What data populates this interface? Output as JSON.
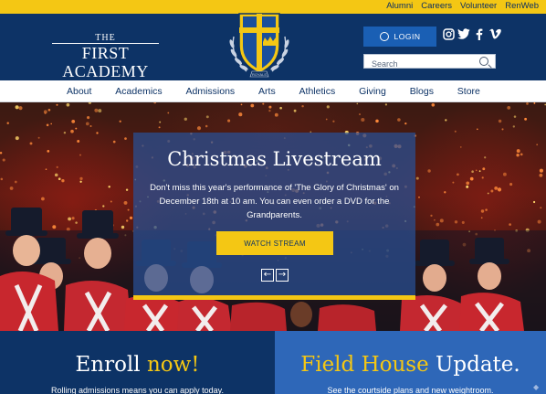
{
  "utility_links": [
    "Alumni",
    "Careers",
    "Volunteer",
    "RenWeb"
  ],
  "logo": {
    "line1": "THE",
    "line2": "FIRST ACADEMY"
  },
  "crest": {
    "label": "ROYALS"
  },
  "login": {
    "label": "LOGIN"
  },
  "social": [
    "instagram-icon",
    "twitter-icon",
    "facebook-icon",
    "vimeo-icon"
  ],
  "search": {
    "placeholder": "Search"
  },
  "nav": [
    "About",
    "Academics",
    "Admissions",
    "Arts",
    "Athletics",
    "Giving",
    "Blogs",
    "Store"
  ],
  "hero": {
    "title": "Christmas Livestream",
    "subtitle": "Don't miss this year's performance of 'The Glory of Christmas' on December 18th at 10 am. You can even order a DVD for the Grandparents.",
    "button": "WATCH STREAM",
    "prev": "←",
    "next": "→"
  },
  "promos": [
    {
      "title_main": "Enroll ",
      "title_highlight": "now!",
      "subtitle": "Rolling admissions means you can apply today."
    },
    {
      "title_highlight": "Field House ",
      "title_main": "Update.",
      "subtitle": "See the courtside plans and new weightroom."
    }
  ],
  "colors": {
    "navy": "#0d3366",
    "gold": "#f4c714",
    "blue": "#2e67b8"
  }
}
